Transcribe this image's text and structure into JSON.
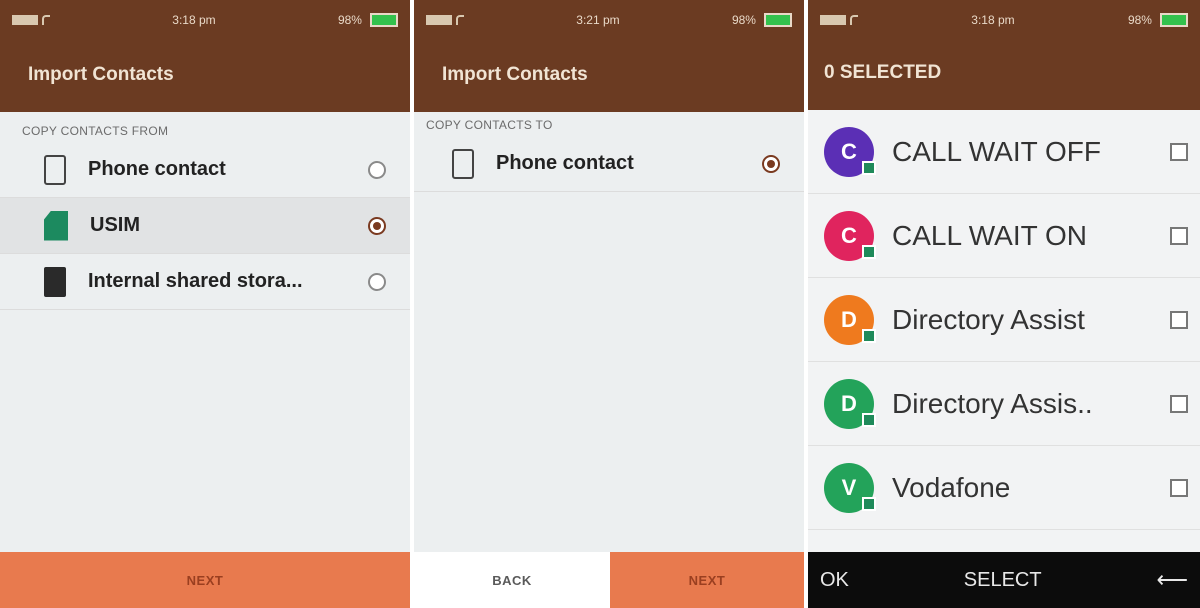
{
  "screens": [
    {
      "status": {
        "time": "3:18 pm",
        "battery": "98%"
      },
      "title": "Import Contacts",
      "section_label": "COPY CONTACTS FROM",
      "options": [
        {
          "label": "Phone contact",
          "icon": "phone-icon",
          "checked": false
        },
        {
          "label": "USIM",
          "icon": "sim-card-icon",
          "checked": true
        },
        {
          "label": "Internal shared stora...",
          "icon": "storage-icon",
          "checked": false
        }
      ],
      "footer": {
        "next_label": "NEXT"
      }
    },
    {
      "status": {
        "time": "3:21 pm",
        "battery": "98%"
      },
      "title": "Import Contacts",
      "section_label": "COPY CONTACTS TO",
      "options": [
        {
          "label": "Phone contact",
          "icon": "phone-icon",
          "checked": true
        }
      ],
      "footer": {
        "back_label": "BACK",
        "next_label": "NEXT"
      }
    },
    {
      "status": {
        "time": "3:18 pm",
        "battery": "98%"
      },
      "title": "0 SELECTED",
      "contacts": [
        {
          "name": "CALL WAIT OFF",
          "initials": "C",
          "avatar_color": "#5b2fb5"
        },
        {
          "name": "CALL WAIT ON",
          "initials": "C",
          "avatar_color": "#e0245e"
        },
        {
          "name": "Directory Assist",
          "initials": "D",
          "avatar_color": "#ef7a1e"
        },
        {
          "name": "Directory Assis..",
          "initials": "D",
          "avatar_color": "#23a35a"
        },
        {
          "name": "Vodafone",
          "initials": "V",
          "avatar_color": "#23a35a"
        }
      ],
      "footer": {
        "left_label": "OK",
        "center_label": "SELECT",
        "back_icon": "back-arrow-icon"
      }
    }
  ],
  "colors": {
    "header": "#6b3b22",
    "accent": "#e87a4e",
    "radio_checked": "#7a3a20"
  }
}
